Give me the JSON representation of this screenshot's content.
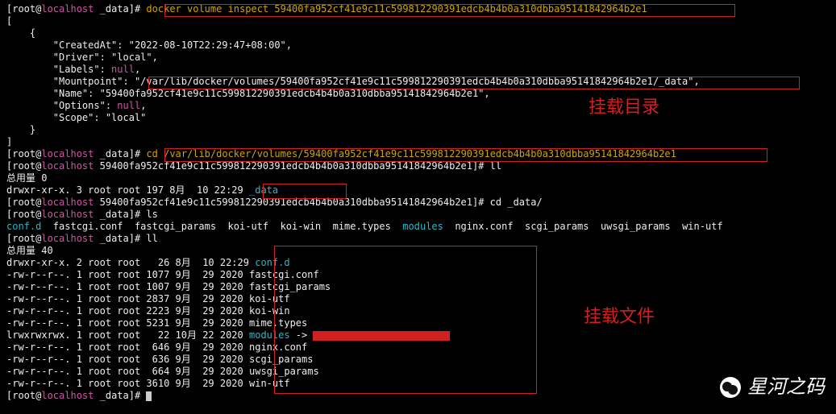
{
  "vol": "59400fa952cf41e9c11c599812290391edcb4b4b0a310dbba95141842964b2e1",
  "mountpath": "/var/lib/docker/volumes/59400fa952cf41e9c11c599812290391edcb4b4b0a310dbba95141842964b2e1/_data",
  "cdpath": "/var/lib/docker/volumes/59400fa952cf41e9c11c599812290391edcb4b4b0a310dbba95141842964b2e1",
  "prompt": {
    "userhost_l": "[root@",
    "host": "localhost",
    "dir_data": " _data]# ",
    "dir_vol": " 59400fa952cf41e9c11c599812290391edcb4b4b0a310dbba95141842964b2e1]# "
  },
  "cmd": {
    "inspect": "docker volume inspect ",
    "cd1": "cd ",
    "ll": "ll",
    "ls": "ls",
    "cddata": "cd _data/"
  },
  "json": {
    "open": "[",
    "obrace": "    {",
    "created": "        \"CreatedAt\": \"2022-08-10T22:29:47+08:00\",",
    "driver": "        \"Driver\": \"local\",",
    "labels": "        \"Labels\": ",
    "null": "null",
    "comma": ",",
    "mount_l": "        \"Mountpoint\": \"",
    "mount_r": "\",",
    "name_l": "        \"Name\": \"",
    "name_r": "\",",
    "options": "        \"Options\": ",
    "scope": "        \"Scope\": \"local\"",
    "cbrace": "    }",
    "close": "]"
  },
  "total0": "总用量 0",
  "total40": "总用量 40",
  "ls_out": {
    "confd": "conf.d",
    "sep1": "  fastcgi.conf  fastcgi_params  koi-utf  koi-win  mime.types  ",
    "modules": "modules",
    "sep2": "  nginx.conf  scgi_params  uwsgi_params  win-utf"
  },
  "dir_data_name": "_data",
  "ll1": "drwxr-xr-x. 3 root root 197 8月  10 22:29 ",
  "ll2": [
    {
      "perm": "drwxr-xr-x. 2 root root   26 8月  10 22:29 ",
      "name": "conf.d",
      "cls": "cyan"
    },
    {
      "perm": "-rw-r--r--. 1 root root 1077 9月  29 2020 ",
      "name": "fastcgi.conf",
      "cls": "white"
    },
    {
      "perm": "-rw-r--r--. 1 root root 1007 9月  29 2020 ",
      "name": "fastcgi_params",
      "cls": "white"
    },
    {
      "perm": "-rw-r--r--. 1 root root 2837 9月  29 2020 ",
      "name": "koi-utf",
      "cls": "white"
    },
    {
      "perm": "-rw-r--r--. 1 root root 2223 9月  29 2020 ",
      "name": "koi-win",
      "cls": "white"
    },
    {
      "perm": "-rw-r--r--. 1 root root 5231 9月  29 2020 ",
      "name": "mime.types",
      "cls": "white"
    },
    {
      "perm": "lrwxrwxrwx. 1 root root   22 10月 22 2020 ",
      "name": "modules",
      "cls": "cyan",
      "arrow": " -> ",
      "target_redact": true
    },
    {
      "perm": "-rw-r--r--. 1 root root  646 9月  29 2020 ",
      "name": "nginx.conf",
      "cls": "white"
    },
    {
      "perm": "-rw-r--r--. 1 root root  636 9月  29 2020 ",
      "name": "scgi_params",
      "cls": "white"
    },
    {
      "perm": "-rw-r--r--. 1 root root  664 9月  29 2020 ",
      "name": "uwsgi_params",
      "cls": "white"
    },
    {
      "perm": "-rw-r--r--. 1 root root 3610 9月  29 2020 ",
      "name": "win-utf",
      "cls": "white"
    }
  ],
  "annot": {
    "mountdir": "挂载目录",
    "mountfile": "挂载文件"
  },
  "watermark": "星河之码"
}
